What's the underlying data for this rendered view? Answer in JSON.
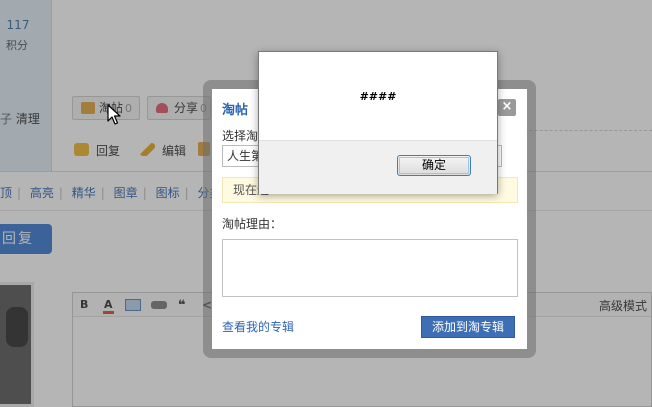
{
  "user_panel": {
    "score_value": "117",
    "score_label": "积分",
    "clean_prefix": "子",
    "clean_label": "清理"
  },
  "post_actions": {
    "tao_label": "淘帖",
    "tao_count": "0",
    "share_label": "分享",
    "share_count": "0"
  },
  "post_links": {
    "reply": "回复",
    "edit": "编辑"
  },
  "mod_tabs": [
    "顶",
    "高亮",
    "精华",
    "图章",
    "图标",
    "分类"
  ],
  "reply_button": "回复",
  "editor": {
    "toolbar": {
      "bold": "B",
      "font_color": "A",
      "quote": "❝",
      "code": "<>"
    },
    "advanced_mode": "高级模式"
  },
  "tao_dialog": {
    "title": "淘帖",
    "close": "×",
    "select_label": "选择淘",
    "selected_album": "人生第",
    "note_text": "现在还",
    "note_tail": "",
    "reason_label": "淘帖理由：",
    "view_albums_link": "查看我的专辑",
    "submit_button": "添加到淘专辑"
  },
  "alert": {
    "message": "####",
    "ok_button": "确定"
  },
  "colors": {
    "link_blue": "#2d64b3",
    "button_blue": "#3e6fb5",
    "reply_blue": "#3d7ad4"
  }
}
